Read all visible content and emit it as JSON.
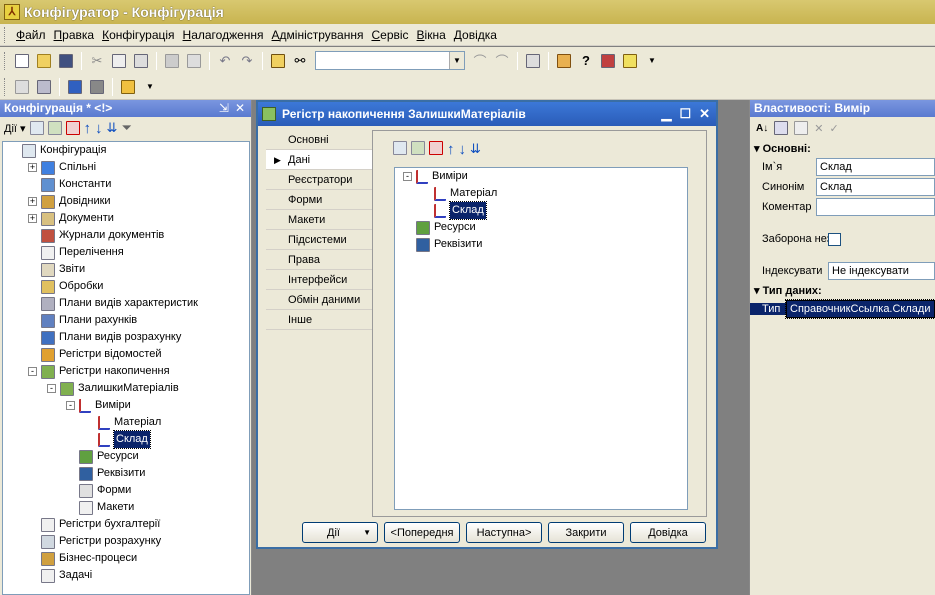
{
  "window": {
    "title": "Конфігуратор - Конфігурація"
  },
  "menu": [
    {
      "key": "Ф",
      "rest": "айл"
    },
    {
      "key": "П",
      "rest": "равка"
    },
    {
      "key": "К",
      "rest": "онфігурація"
    },
    {
      "key": "Н",
      "rest": "алагодження"
    },
    {
      "key": "А",
      "rest": "дміністрування"
    },
    {
      "key": "С",
      "rest": "ервіс"
    },
    {
      "key": "В",
      "rest": "ікна"
    },
    {
      "key": "Д",
      "rest": "овідка"
    }
  ],
  "left_panel": {
    "title": "Конфігурація * <!>",
    "actions_label": "Дії",
    "tree": [
      {
        "label": "Конфігурація",
        "level": 0,
        "expander": "",
        "icon": "config-icon"
      },
      {
        "label": "Спільні",
        "level": 1,
        "expander": "+",
        "icon": "common-icon"
      },
      {
        "label": "Константи",
        "level": 1,
        "expander": "",
        "icon": "constants-icon"
      },
      {
        "label": "Довідники",
        "level": 1,
        "expander": "+",
        "icon": "catalogs-icon"
      },
      {
        "label": "Документи",
        "level": 1,
        "expander": "+",
        "icon": "documents-icon"
      },
      {
        "label": "Журнали документів",
        "level": 1,
        "expander": "",
        "icon": "journals-icon"
      },
      {
        "label": "Перелічення",
        "level": 1,
        "expander": "",
        "icon": "enums-icon"
      },
      {
        "label": "Звіти",
        "level": 1,
        "expander": "",
        "icon": "reports-icon"
      },
      {
        "label": "Обробки",
        "level": 1,
        "expander": "",
        "icon": "dataprocessors-icon"
      },
      {
        "label": "Плани видів характеристик",
        "level": 1,
        "expander": "",
        "icon": "charttypes-icon"
      },
      {
        "label": "Плани рахунків",
        "level": 1,
        "expander": "",
        "icon": "accounts-icon"
      },
      {
        "label": "Плани видів розрахунку",
        "level": 1,
        "expander": "",
        "icon": "calctypes-icon"
      },
      {
        "label": "Регістри відомостей",
        "level": 1,
        "expander": "",
        "icon": "info-registers-icon"
      },
      {
        "label": "Регістри накопичення",
        "level": 1,
        "expander": "-",
        "icon": "accum-registers-icon"
      },
      {
        "label": "ЗалишкиМатеріалів",
        "level": 2,
        "expander": "-",
        "icon": "register-icon"
      },
      {
        "label": "Виміри",
        "level": 3,
        "expander": "-",
        "icon": "dimensions-icon"
      },
      {
        "label": "Матеріал",
        "level": 4,
        "expander": "",
        "icon": "dimension-icon"
      },
      {
        "label": "Склад",
        "level": 4,
        "expander": "",
        "icon": "dimension-icon",
        "selected": true
      },
      {
        "label": "Ресурси",
        "level": 3,
        "expander": "",
        "icon": "resources-icon"
      },
      {
        "label": "Реквізити",
        "level": 3,
        "expander": "",
        "icon": "attributes-icon"
      },
      {
        "label": "Форми",
        "level": 3,
        "expander": "",
        "icon": "forms-icon"
      },
      {
        "label": "Макети",
        "level": 3,
        "expander": "",
        "icon": "templates-icon"
      },
      {
        "label": "Регістри бухгалтерії",
        "level": 1,
        "expander": "",
        "icon": "accounting-registers-icon"
      },
      {
        "label": "Регістри розрахунку",
        "level": 1,
        "expander": "",
        "icon": "calc-registers-icon"
      },
      {
        "label": "Бізнес-процеси",
        "level": 1,
        "expander": "",
        "icon": "business-processes-icon"
      },
      {
        "label": "Задачі",
        "level": 1,
        "expander": "",
        "icon": "tasks-icon"
      }
    ]
  },
  "modal": {
    "title": "Регістр накопичення ЗалишкиМатеріалів",
    "tabs": [
      "Основні",
      "Дані",
      "Реєстратори",
      "Форми",
      "Макети",
      "Підсистеми",
      "Права",
      "Інтерфейси",
      "Обмін даними",
      "Інше"
    ],
    "active_tab": 1,
    "tree": [
      {
        "label": "Виміри",
        "level": 0,
        "expander": "-",
        "icon": "dimensions-icon"
      },
      {
        "label": "Матеріал",
        "level": 1,
        "expander": "",
        "icon": "dimension-icon"
      },
      {
        "label": "Склад",
        "level": 1,
        "expander": "",
        "icon": "dimension-icon",
        "selected": true
      },
      {
        "label": "Ресурси",
        "level": 0,
        "expander": "",
        "icon": "resources-icon"
      },
      {
        "label": "Реквізити",
        "level": 0,
        "expander": "",
        "icon": "attributes-icon"
      }
    ],
    "buttons": {
      "actions": "Дії",
      "prev": "<Попередня",
      "next": "Наступна>",
      "close": "Закрити",
      "help": "Довідка"
    }
  },
  "right_panel": {
    "title": "Властивості: Вимір",
    "section_main": "Основні:",
    "name_label": "Ім`я",
    "name_value": "Склад",
    "synonym_label": "Синонім",
    "synonym_value": "Склад",
    "comment_label": "Коментар",
    "comment_value": "",
    "deny_label": "Заборона незаповнених",
    "index_label": "Індексувати",
    "index_value": "Не індексувати",
    "section_type": "Тип даних:",
    "type_label": "Тип",
    "type_value": "СправочникСсылка.Склади"
  }
}
